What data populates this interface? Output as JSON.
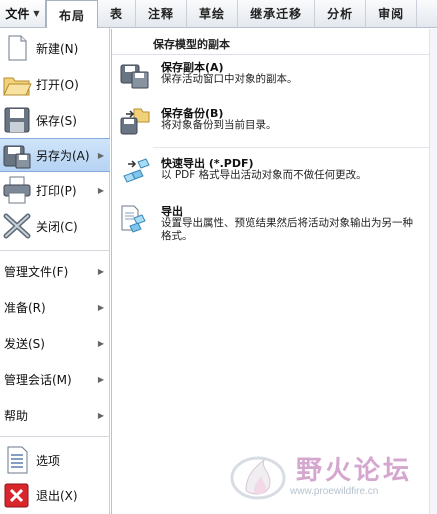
{
  "ribbon": {
    "file_tab": "文件",
    "tabs": [
      "布局",
      "表",
      "注释",
      "草绘",
      "继承迁移",
      "分析",
      "审阅"
    ]
  },
  "left_menu": {
    "new": "新建(N)",
    "open": "打开(O)",
    "save": "保存(S)",
    "save_as": "另存为(A)",
    "print": "打印(P)",
    "close": "关闭(C)",
    "manage_file": "管理文件(F)",
    "prepare": "准备(R)",
    "send": "发送(S)",
    "manage_session": "管理会话(M)",
    "help": "帮助",
    "options": "选项",
    "exit": "退出(X)"
  },
  "submenu": {
    "header": "保存模型的副本",
    "items": [
      {
        "title": "保存副本(A)",
        "desc": "保存活动窗口中对象的副本。"
      },
      {
        "title": "保存备份(B)",
        "desc": "将对象备份到当前目录。"
      },
      {
        "title": "快速导出 (*.PDF)",
        "desc": "以 PDF 格式导出活动对象而不做任何更改。"
      },
      {
        "title": "导出",
        "desc": "设置导出属性、预览结果然后将活动对象输出为另一种格式。"
      }
    ]
  },
  "watermark": {
    "brand": "野火论坛",
    "url": "www.proewildfire.cn"
  }
}
